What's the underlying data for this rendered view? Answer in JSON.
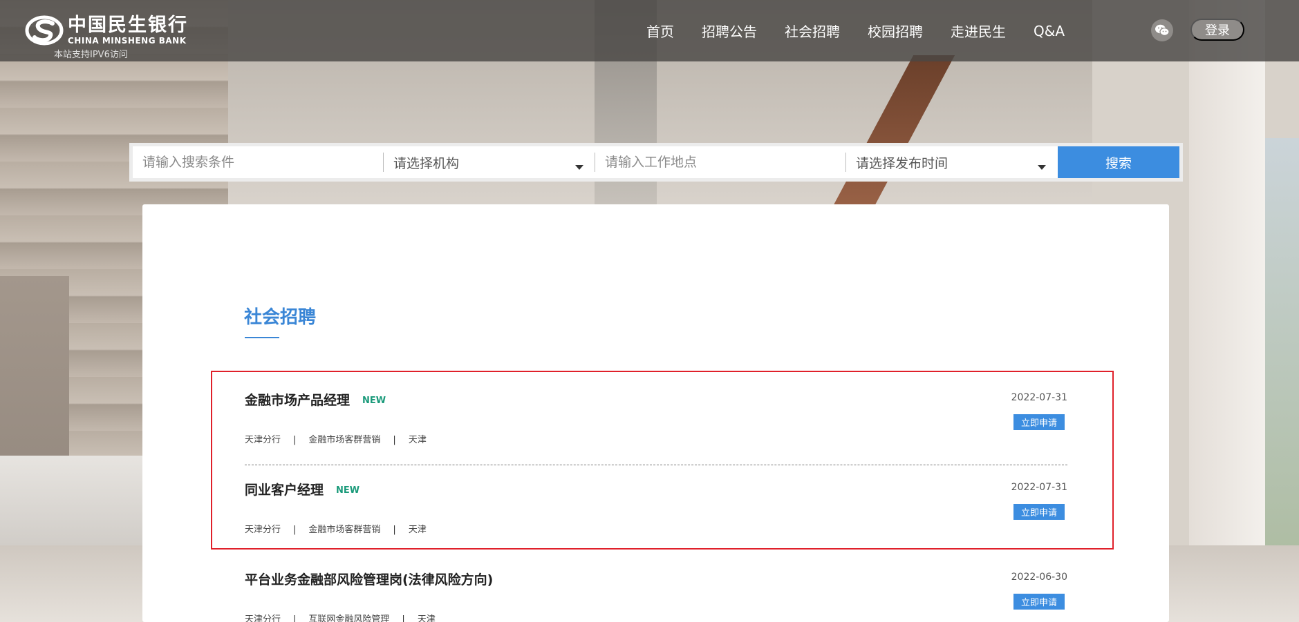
{
  "header": {
    "logo_cn": "中国民生银行",
    "logo_en": "CHINA MINSHENG BANK",
    "ipv6_note": "本站支持IPV6访问",
    "nav": [
      "首页",
      "招聘公告",
      "社会招聘",
      "校园招聘",
      "走进民生",
      "Q&A"
    ],
    "login_label": "登录"
  },
  "search": {
    "keyword_placeholder": "请输入搜索条件",
    "org_placeholder": "请选择机构",
    "location_placeholder": "请输入工作地点",
    "time_placeholder": "请选择发布时间",
    "button_label": "搜索"
  },
  "section": {
    "title": "社会招聘"
  },
  "jobs": [
    {
      "title": "金融市场产品经理",
      "badge": "NEW",
      "branch": "天津分行",
      "department": "金融市场客群营销",
      "city": "天津",
      "date": "2022-07-31",
      "apply_label": "立即申请"
    },
    {
      "title": "同业客户经理",
      "badge": "NEW",
      "branch": "天津分行",
      "department": "金融市场客群营销",
      "city": "天津",
      "date": "2022-07-31",
      "apply_label": "立即申请"
    },
    {
      "title": "平台业务金融部风险管理岗(法律风险方向)",
      "badge": "",
      "branch": "天津分行",
      "department": "互联网金融风险管理",
      "city": "天津",
      "date": "2022-06-30",
      "apply_label": "立即申请"
    }
  ],
  "meta_separator": "|",
  "colors": {
    "accent": "#3c8de0",
    "new_badge": "#1a9a7a",
    "highlight": "#e0202a",
    "header_bg": "#4b4846"
  }
}
